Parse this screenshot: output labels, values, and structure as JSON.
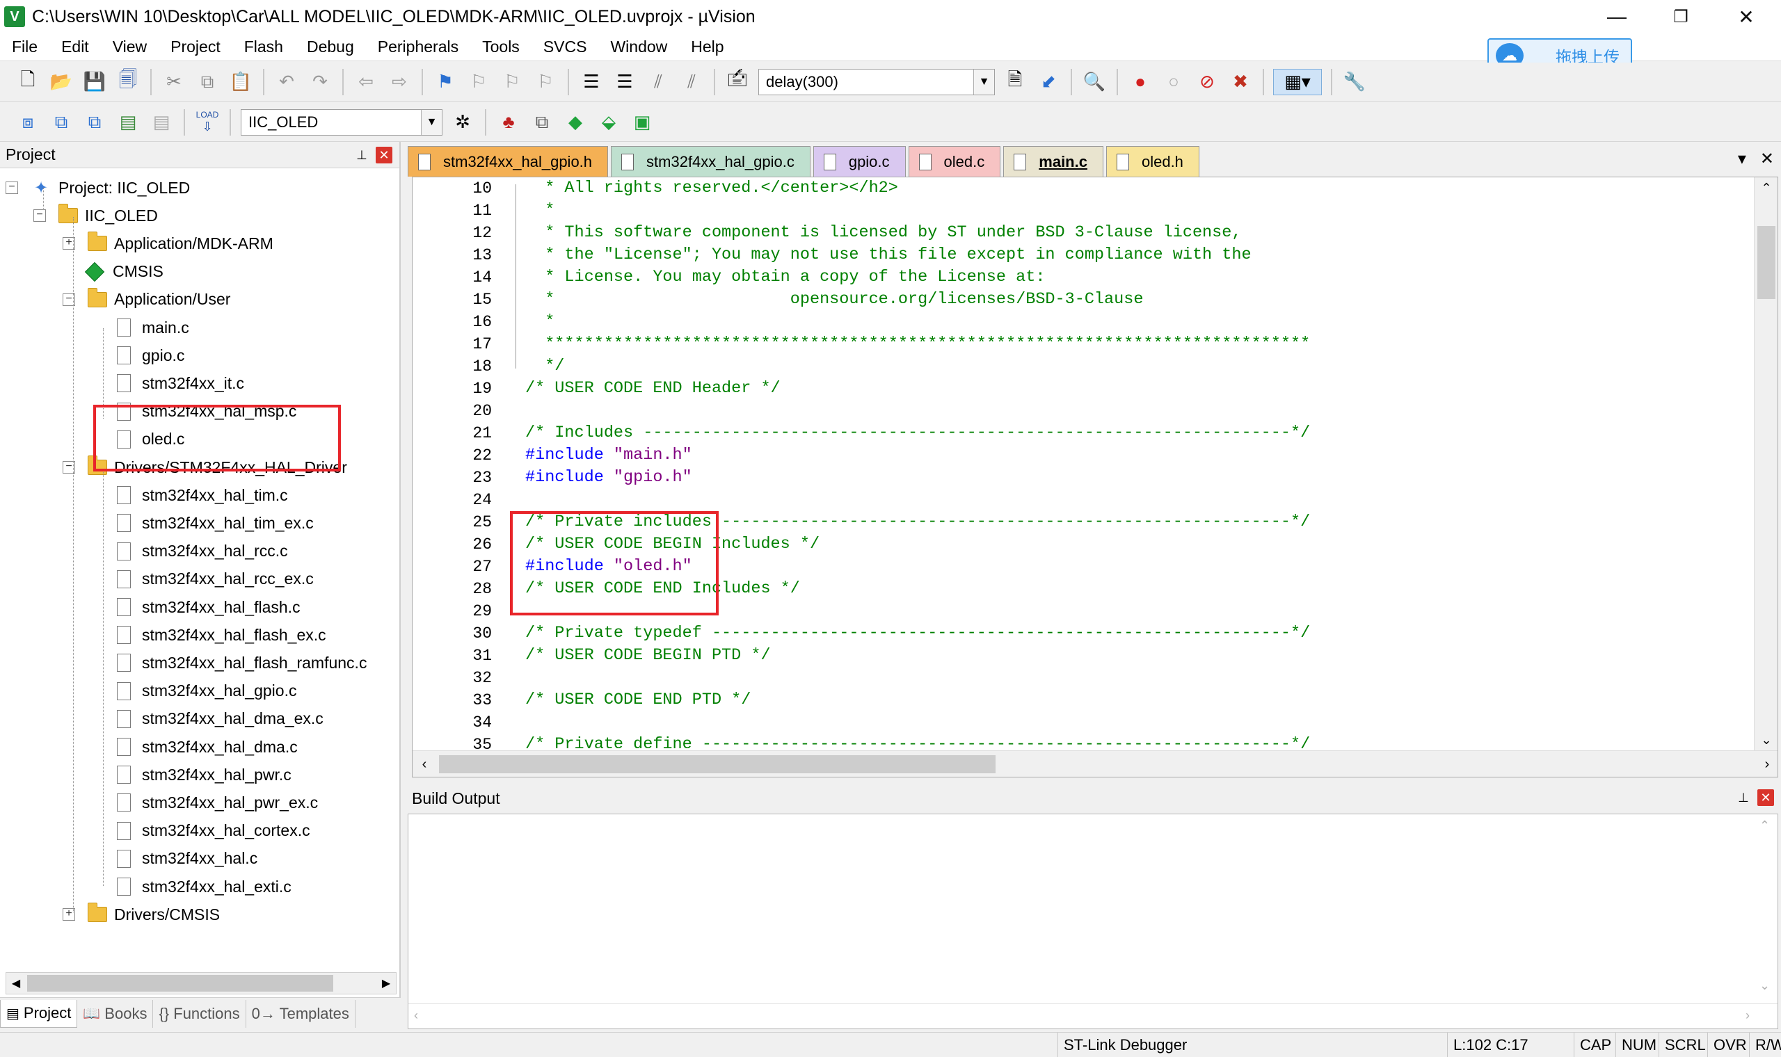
{
  "window": {
    "title": "C:\\Users\\WIN 10\\Desktop\\Car\\ALL MODEL\\IIC_OLED\\MDK-ARM\\IIC_OLED.uvprojx - µVision",
    "icon_letter": "V",
    "minimize": "—",
    "restore": "❐",
    "close": "✕"
  },
  "menu": [
    "File",
    "Edit",
    "View",
    "Project",
    "Flash",
    "Debug",
    "Peripherals",
    "Tools",
    "SVCS",
    "Window",
    "Help"
  ],
  "upload": {
    "label": "拖拽上传",
    "icon": "cloud-icon"
  },
  "toolbar1": {
    "find_value": "delay(300)"
  },
  "toolbar2": {
    "target_value": "IIC_OLED",
    "load_label": "LOAD"
  },
  "project_panel": {
    "title": "Project",
    "pin": "📌",
    "close": "✕",
    "tree": {
      "project": "Project: IIC_OLED",
      "target": "IIC_OLED",
      "groups": [
        {
          "name": "Application/MDK-ARM"
        },
        {
          "name": "CMSIS"
        },
        {
          "name": "Application/User",
          "files": [
            "main.c",
            "gpio.c",
            "stm32f4xx_it.c",
            "stm32f4xx_hal_msp.c",
            "oled.c"
          ]
        },
        {
          "name": "Drivers/STM32F4xx_HAL_Driver",
          "files": [
            "stm32f4xx_hal_tim.c",
            "stm32f4xx_hal_tim_ex.c",
            "stm32f4xx_hal_rcc.c",
            "stm32f4xx_hal_rcc_ex.c",
            "stm32f4xx_hal_flash.c",
            "stm32f4xx_hal_flash_ex.c",
            "stm32f4xx_hal_flash_ramfunc.c",
            "stm32f4xx_hal_gpio.c",
            "stm32f4xx_hal_dma_ex.c",
            "stm32f4xx_hal_dma.c",
            "stm32f4xx_hal_pwr.c",
            "stm32f4xx_hal_pwr_ex.c",
            "stm32f4xx_hal_cortex.c",
            "stm32f4xx_hal.c",
            "stm32f4xx_hal_exti.c"
          ]
        },
        {
          "name": "Drivers/CMSIS"
        }
      ]
    },
    "tabs": [
      {
        "label": "Project",
        "icon": "project-icon"
      },
      {
        "label": "Books",
        "icon": "books-icon"
      },
      {
        "label": "{} Functions",
        "icon": "functions-icon"
      },
      {
        "label": "0→ Templates",
        "icon": "templates-icon"
      }
    ]
  },
  "file_tabs": [
    {
      "label": "stm32f4xx_hal_gpio.h",
      "color": "#f4b054"
    },
    {
      "label": "stm32f4xx_hal_gpio.c",
      "color": "#bfe0cf"
    },
    {
      "label": "gpio.c",
      "color": "#d9c8f0"
    },
    {
      "label": "oled.c",
      "color": "#f7c3c3"
    },
    {
      "label": "main.c",
      "color": "#e9e4cf"
    },
    {
      "label": "oled.h",
      "color": "#f8e49a"
    }
  ],
  "code": {
    "line_numbers": [
      "10",
      "11",
      "12",
      "13",
      "14",
      "15",
      "16",
      "17",
      "18",
      "19",
      "20",
      "21",
      "22",
      "23",
      "24",
      "25",
      "26",
      "27",
      "28",
      "29",
      "30",
      "31",
      "32",
      "33",
      "34",
      "35"
    ],
    "lines": [
      [
        {
          "t": "  * All rights reserved.</center></h2>",
          "c": "c-comment"
        }
      ],
      [
        {
          "t": "  *",
          "c": "c-comment"
        }
      ],
      [
        {
          "t": "  * This software component is licensed by ST under BSD 3-Clause license,",
          "c": "c-comment"
        }
      ],
      [
        {
          "t": "  * the \"License\"; You may not use this file except in compliance with the",
          "c": "c-comment"
        }
      ],
      [
        {
          "t": "  * License. You may obtain a copy of the License at:",
          "c": "c-comment"
        }
      ],
      [
        {
          "t": "  *                        opensource.org/licenses/BSD-3-Clause",
          "c": "c-comment"
        }
      ],
      [
        {
          "t": "  *",
          "c": "c-comment"
        }
      ],
      [
        {
          "t": "  ******************************************************************************",
          "c": "c-comment"
        }
      ],
      [
        {
          "t": "  */",
          "c": "c-comment"
        }
      ],
      [
        {
          "t": "/* USER CODE END Header */",
          "c": "c-comment"
        }
      ],
      [
        {
          "t": "",
          "c": ""
        }
      ],
      [
        {
          "t": "/* Includes ------------------------------------------------------------------*/",
          "c": "c-comment"
        }
      ],
      [
        {
          "t": "#include ",
          "c": "c-pre"
        },
        {
          "t": "\"main.h\"",
          "c": "c-str"
        }
      ],
      [
        {
          "t": "#include ",
          "c": "c-pre"
        },
        {
          "t": "\"gpio.h\"",
          "c": "c-str"
        }
      ],
      [
        {
          "t": "",
          "c": ""
        }
      ],
      [
        {
          "t": "/* Private includes ----------------------------------------------------------*/",
          "c": "c-comment"
        }
      ],
      [
        {
          "t": "/* USER CODE BEGIN Includes */",
          "c": "c-comment"
        }
      ],
      [
        {
          "t": "#include ",
          "c": "c-pre"
        },
        {
          "t": "\"oled.h\"",
          "c": "c-str"
        }
      ],
      [
        {
          "t": "/* USER CODE END Includes */",
          "c": "c-comment"
        }
      ],
      [
        {
          "t": "",
          "c": ""
        }
      ],
      [
        {
          "t": "/* Private typedef -----------------------------------------------------------*/",
          "c": "c-comment"
        }
      ],
      [
        {
          "t": "/* USER CODE BEGIN PTD */",
          "c": "c-comment"
        }
      ],
      [
        {
          "t": "",
          "c": ""
        }
      ],
      [
        {
          "t": "/* USER CODE END PTD */",
          "c": "c-comment"
        }
      ],
      [
        {
          "t": "",
          "c": ""
        }
      ],
      [
        {
          "t": "/* Private define ------------------------------------------------------------*/",
          "c": "c-comment"
        }
      ]
    ]
  },
  "build_output": {
    "title": "Build Output",
    "content": ""
  },
  "status": {
    "debugger": "ST-Link Debugger",
    "position": "L:102 C:17",
    "cap": "CAP",
    "num": "NUM",
    "scrl": "SCRL",
    "ovr": "OVR",
    "rw": "R/W"
  }
}
